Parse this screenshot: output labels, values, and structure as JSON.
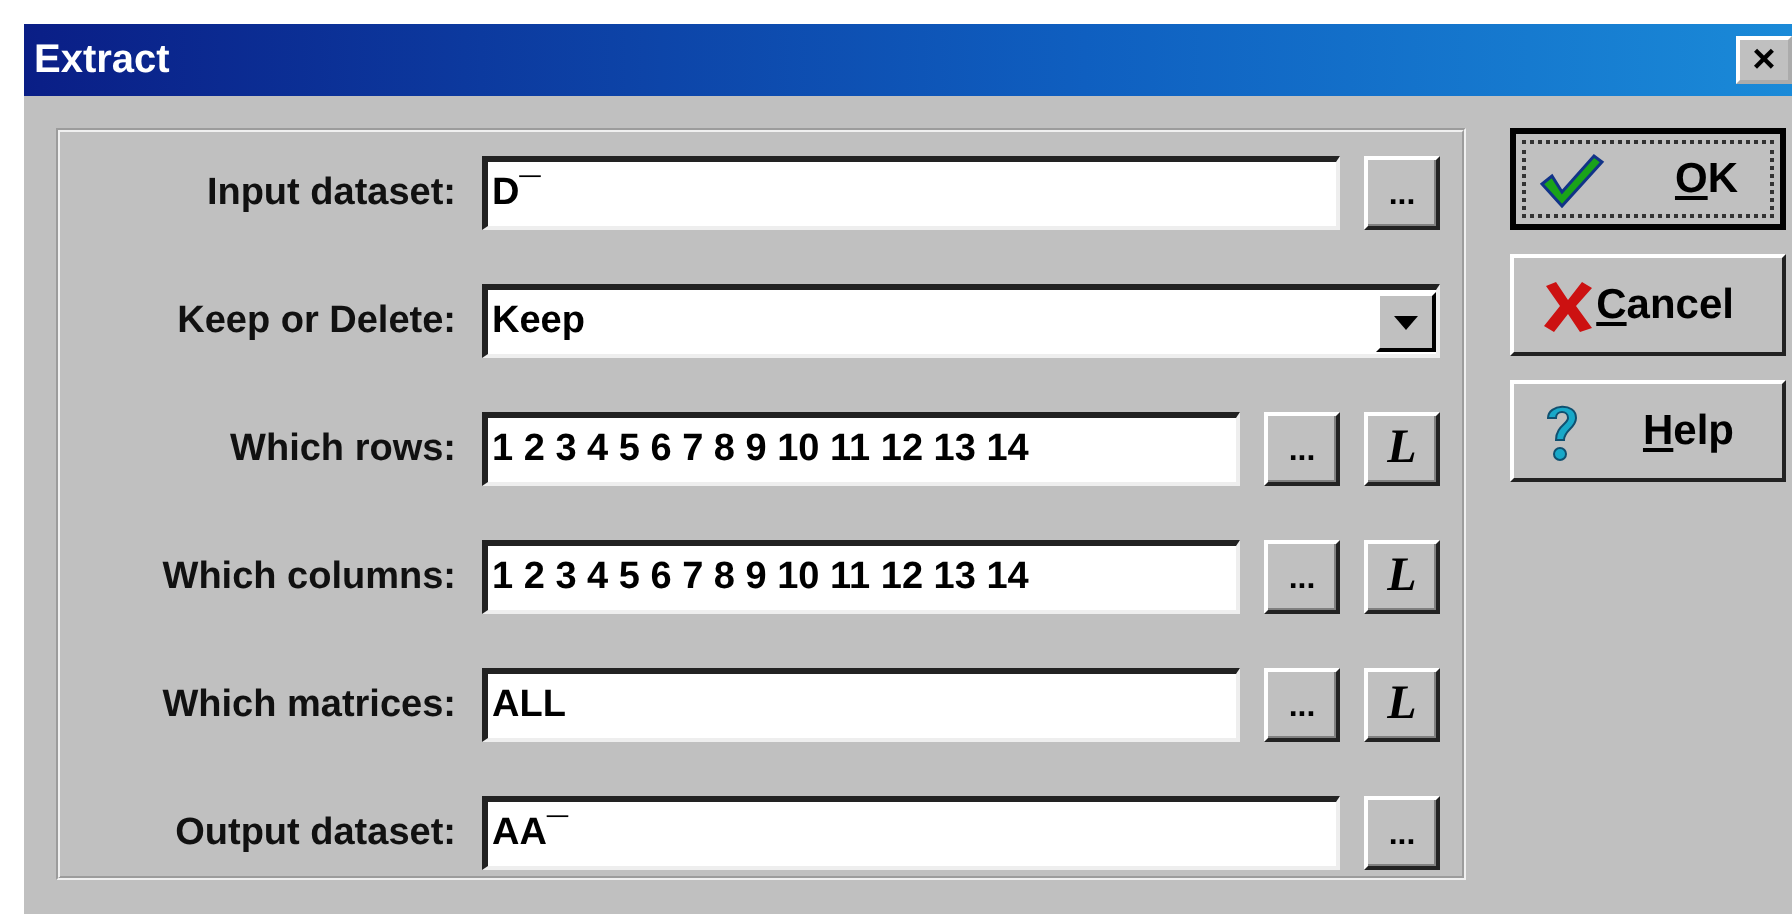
{
  "window": {
    "title": "Extract",
    "close": "×"
  },
  "rows": [
    {
      "kind": "file",
      "label": "Input dataset:",
      "value": "D¯",
      "browse": "..."
    },
    {
      "kind": "combo",
      "label": "Keep or Delete:",
      "value": "Keep"
    },
    {
      "kind": "list",
      "label": "Which rows:",
      "value": "1 2 3 4 5 6 7 8 9 10 11 12 13 14",
      "browse": "...",
      "list": "L"
    },
    {
      "kind": "list",
      "label": "Which columns:",
      "value": "1 2 3 4 5 6 7 8 9 10 11 12 13 14",
      "browse": "...",
      "list": "L"
    },
    {
      "kind": "list",
      "label": "Which matrices:",
      "value": "ALL",
      "browse": "...",
      "list": "L"
    },
    {
      "kind": "file",
      "label": "Output dataset:",
      "value": "AA¯",
      "browse": "..."
    }
  ],
  "buttons": [
    {
      "kind": "ok",
      "key": "O",
      "rest": "K",
      "default": true
    },
    {
      "kind": "cancel",
      "key": "C",
      "rest": "ancel",
      "default": false
    },
    {
      "kind": "help",
      "key": "H",
      "rest": "elp",
      "default": false
    }
  ]
}
